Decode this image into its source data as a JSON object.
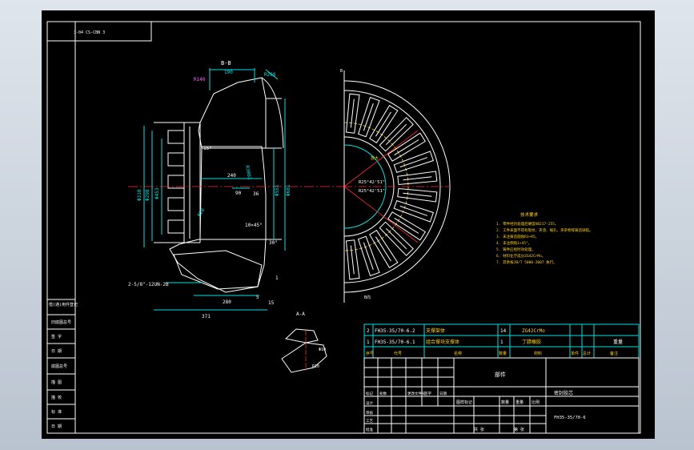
{
  "frame_code": "3-04 CS-CBN 3",
  "sections": {
    "bb": "B-B",
    "aa": "A-A",
    "b_mark": "B"
  },
  "dims_left": {
    "d190": "190",
    "r268": "R268",
    "d240": "240",
    "d90": "90",
    "d36": "36",
    "d310": "Φ310",
    "d298": "Φ298",
    "d453": "Φ453",
    "d551": "Φ551",
    "d601": "Φ601",
    "ang15": "15°",
    "ang30": "30°",
    "r20": "R20",
    "r140": "R140",
    "d5": "5",
    "d15": "15",
    "d280": "280",
    "d371": "371",
    "chamfer": "10×45°",
    "thread": "2-5/8\"-12UN-2B",
    "one": "1",
    "r3002": "R3002"
  },
  "dims_right": {
    "r1": "R25°42'51\"",
    "r2": "R25°42'51\"",
    "b_label": "B向",
    "zoom": "放大"
  },
  "dims_aa": {
    "d10": "Φ10",
    "r10": "R10"
  },
  "tech_req": {
    "title": "技术要求",
    "lines": [
      "1. 零件经热处理后硬度HB217-255。",
      "2. 工件表面不得有裂纹、夹渣、缩孔、夹杂物等铸造缺陷。",
      "3. 未注铸造圆角R3~R5。",
      "4. 未注倒角1×45°。",
      "5. 铸件应经时效处理。",
      "6. 材料化学成分ZG42CrMo。",
      "7. 其余按JB/T 5000-2007 执行。"
    ]
  },
  "left_panel": [
    "借(通)用件登记",
    "旧底图总号",
    "签 字",
    "日 期",
    "底图总号",
    "描 图",
    "描 校",
    "标 准",
    "日 期"
  ],
  "parts_list": {
    "rows": [
      [
        "2",
        "FH35-35/70-6.2",
        "支撑架体",
        "14",
        "ZG42CrMo",
        "",
        "",
        ""
      ],
      [
        "1",
        "FH35-35/70-6.1",
        "组合撑块支撑体",
        "1",
        "丁腈橡胶",
        "",
        "",
        ""
      ]
    ],
    "header": [
      "序号",
      "代号",
      "名称",
      "数量",
      "材料",
      "单件",
      "总计",
      "备注"
    ],
    "weight": "重量"
  },
  "title_block": {
    "name": "部件",
    "drawing_no": "FH35-35/70-6",
    "company": "密封胶芯",
    "stage": "图样标记",
    "qty": "数量",
    "weight": "重量",
    "scale": "比例",
    "designer": "设计",
    "checker": "审核",
    "process": "工艺",
    "approve": "批准",
    "sheet1": "共 张",
    "sheet2": "第 张",
    "mark": "标记",
    "count": "处数",
    "change": "更改文件号",
    "sign": "签字",
    "date": "日期"
  },
  "colors": {
    "background": "#000000",
    "line": "#ffffff",
    "dim": "#00e0e0",
    "center": "#ff2a2a",
    "text": "#ffd21f"
  }
}
